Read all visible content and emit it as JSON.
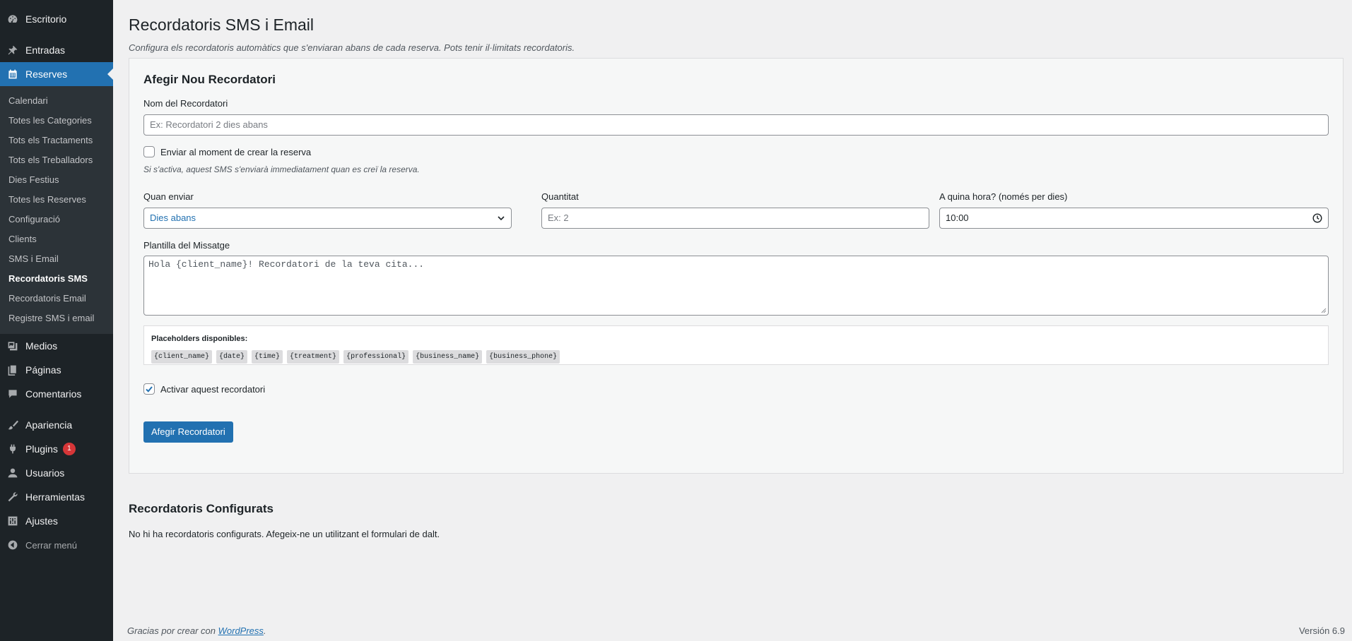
{
  "sidebar": {
    "items": [
      {
        "label": "Escritorio",
        "icon": "dashboard-icon"
      },
      {
        "label": "Entradas",
        "icon": "pin-icon"
      },
      {
        "label": "Reserves",
        "icon": "calendar-icon"
      },
      {
        "label": "Medios",
        "icon": "media-icon"
      },
      {
        "label": "Páginas",
        "icon": "pages-icon"
      },
      {
        "label": "Comentarios",
        "icon": "comments-icon"
      },
      {
        "label": "Apariencia",
        "icon": "brush-icon"
      },
      {
        "label": "Plugins",
        "icon": "plugins-icon",
        "badge": "1"
      },
      {
        "label": "Usuarios",
        "icon": "users-icon"
      },
      {
        "label": "Herramientas",
        "icon": "wrench-icon"
      },
      {
        "label": "Ajustes",
        "icon": "settings-icon"
      },
      {
        "label": "Cerrar menú",
        "icon": "collapse-icon"
      }
    ],
    "submenu": [
      "Calendari",
      "Totes les Categories",
      "Tots els Tractaments",
      "Tots els Treballadors",
      "Dies Festius",
      "Totes les Reserves",
      "Configuració",
      "Clients",
      "SMS i Email",
      "Recordatoris SMS",
      "Recordatoris Email",
      "Registre SMS i email"
    ],
    "current_submenu": "Recordatoris SMS"
  },
  "page": {
    "title": "Recordatoris SMS i Email",
    "description": "Configura els recordatoris automàtics que s'enviaran abans de cada reserva. Pots tenir il·limitats recordatoris."
  },
  "form": {
    "heading": "Afegir Nou Recordatori",
    "name_label": "Nom del Recordatori",
    "name_placeholder": "Ex: Recordatori 2 dies abans",
    "send_now_label": "Enviar al moment de crear la reserva",
    "send_now_checked": false,
    "send_now_hint": "Si s'activa, aquest SMS s'enviarà immediatament quan es creï la reserva.",
    "when_label": "Quan enviar",
    "when_value": "Dies abans",
    "qty_label": "Quantitat",
    "qty_placeholder": "Ex: 2",
    "time_label": "A quina hora? (només per dies)",
    "time_value": "10:00",
    "template_label": "Plantilla del Missatge",
    "template_placeholder": "Hola {client_name}! Recordatori de la teva cita...",
    "placeholders_title": "Placeholders disponibles:",
    "placeholders": [
      "{client_name}",
      "{date}",
      "{time}",
      "{treatment}",
      "{professional}",
      "{business_name}",
      "{business_phone}"
    ],
    "active_label": "Activar aquest recordatori",
    "active_checked": true,
    "submit_label": "Afegir Recordatori"
  },
  "configured": {
    "heading": "Recordatoris Configurats",
    "empty_text": "No hi ha recordatoris configurats. Afegeix-ne un utilitzant el formulari de dalt."
  },
  "footer": {
    "thanks_prefix": "Gracias por crear con ",
    "thanks_link": "WordPress",
    "thanks_suffix": ".",
    "version": "Versión 6.9"
  },
  "colors": {
    "accent": "#2271b1",
    "sidebar_bg": "#1d2327",
    "badge": "#d63638"
  }
}
